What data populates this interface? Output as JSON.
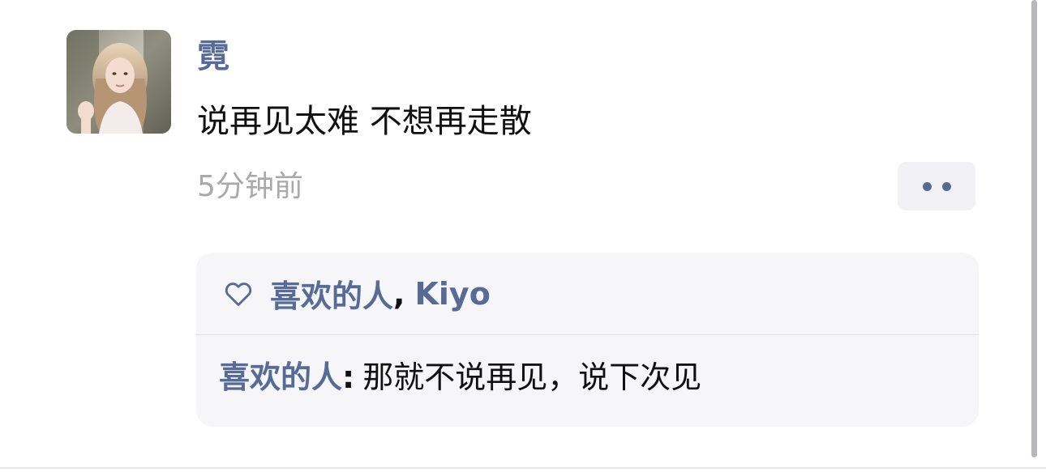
{
  "post": {
    "author": "霓",
    "content": "说再见太难 不想再走散",
    "timestamp": "5分钟前",
    "avatar_alt": "user-avatar"
  },
  "likes": {
    "icon": "heart-outline-icon",
    "names": [
      "喜欢的人",
      "Kiyo"
    ],
    "separator": ","
  },
  "comments": [
    {
      "author": "喜欢的人",
      "colon": ":",
      "text": "那就不说再见，说下次见"
    }
  ],
  "colors": {
    "link": "#576b95",
    "text": "#111111",
    "muted": "#a9a9a9",
    "panel": "#f6f6f8"
  }
}
